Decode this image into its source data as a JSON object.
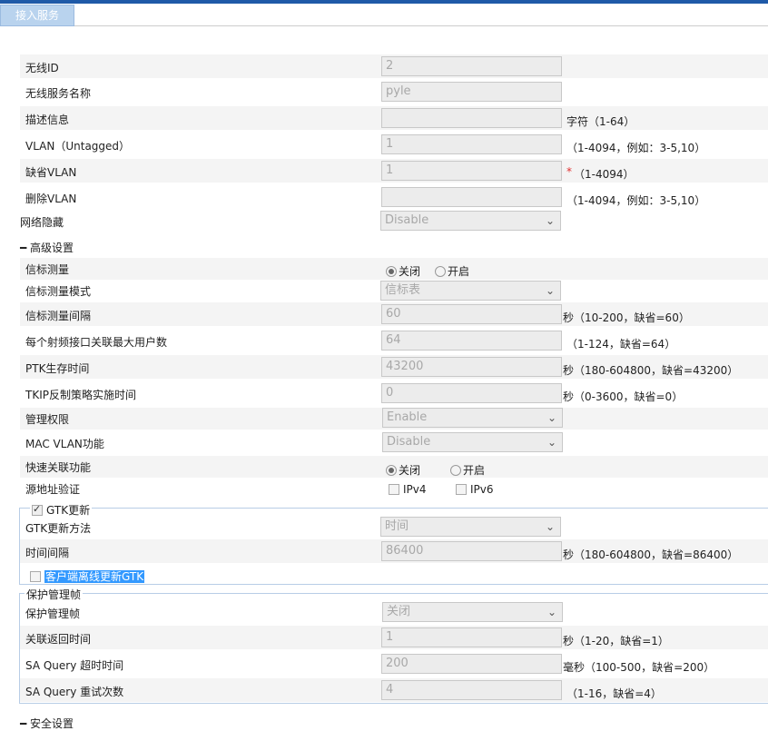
{
  "tab": "接入服务",
  "fields": {
    "wireless_id": {
      "label": "无线ID",
      "value": "2"
    },
    "service_name": {
      "label": "无线服务名称",
      "value": "pyle"
    },
    "description": {
      "label": "描述信息",
      "value": "",
      "hint": "字符（1-64）"
    },
    "vlan_untagged": {
      "label": "VLAN（Untagged）",
      "value": "1",
      "hint": "（1-4094，例如：3-5,10）"
    },
    "default_vlan": {
      "label": "缺省VLAN",
      "value": "1",
      "required": "*",
      "hint": "（1-4094）"
    },
    "delete_vlan": {
      "label": "删除VLAN",
      "value": "",
      "hint": "（1-4094，例如：3-5,10）"
    },
    "ssid_hide": {
      "label": "网络隐藏",
      "value": "Disable"
    }
  },
  "advanced": {
    "title": "高级设置",
    "beacon_measure": {
      "label": "信标测量",
      "off": "关闭",
      "on": "开启"
    },
    "beacon_mode": {
      "label": "信标测量模式",
      "value": "信标表"
    },
    "beacon_interval": {
      "label": "信标测量间隔",
      "value": "60",
      "hint": "秒（10-200，缺省=60）"
    },
    "max_users": {
      "label": "每个射频接口关联最大用户数",
      "value": "64",
      "hint": "（1-124，缺省=64）"
    },
    "ptk_lifetime": {
      "label": "PTK生存时间",
      "value": "43200",
      "hint": "秒（180-604800，缺省=43200）"
    },
    "tkip_time": {
      "label": "TKIP反制策略实施时间",
      "value": "0",
      "hint": "秒（0-3600，缺省=0）"
    },
    "mgmt_right": {
      "label": "管理权限",
      "value": "Enable"
    },
    "mac_vlan": {
      "label": "MAC VLAN功能",
      "value": "Disable"
    },
    "fast_assoc": {
      "label": "快速关联功能",
      "off": "关闭",
      "on": "开启"
    },
    "source_verify": {
      "label": "源地址验证",
      "ipv4": "IPv4",
      "ipv6": "IPv6"
    }
  },
  "gtk": {
    "legend": "GTK更新",
    "method": {
      "label": "GTK更新方法",
      "value": "时间"
    },
    "interval": {
      "label": "时间间隔",
      "value": "86400",
      "hint": "秒（180-604800，缺省=86400）"
    },
    "offline_update": "客户端离线更新GTK"
  },
  "pmf": {
    "legend": "保护管理帧",
    "pmf": {
      "label": "保护管理帧",
      "value": "关闭"
    },
    "assoc_comeback": {
      "label": "关联返回时间",
      "value": "1",
      "hint": "秒（1-20，缺省=1）"
    },
    "sa_timeout": {
      "label": "SA Query 超时时间",
      "value": "200",
      "hint": "毫秒（100-500，缺省=200）"
    },
    "sa_retry": {
      "label": "SA Query 重试次数",
      "value": "4",
      "hint": "（1-16，缺省=4）"
    }
  },
  "security": {
    "title": "安全设置"
  }
}
